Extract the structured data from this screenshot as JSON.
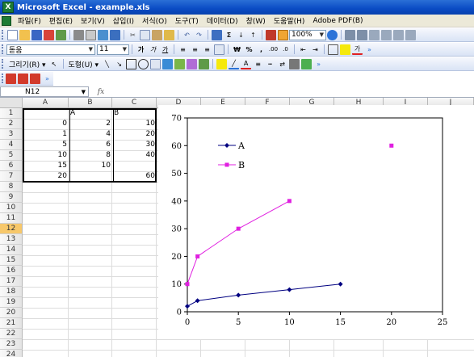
{
  "window": {
    "title": "Microsoft Excel - example.xls",
    "app_icon_label": "X"
  },
  "menu": [
    "파일(F)",
    "편집(E)",
    "보기(V)",
    "삽입(I)",
    "서식(O)",
    "도구(T)",
    "데이터(D)",
    "창(W)",
    "도움말(H)",
    "Adobe PDF(B)"
  ],
  "toolbar_standard": {
    "zoom": "100%",
    "sigma_label": "Σ"
  },
  "toolbar_format": {
    "font": "돋움",
    "size": "11",
    "bold": "가",
    "italic": "가",
    "underline": "가",
    "currency": "₩",
    "percent": "%",
    "comma": ",",
    "inc_decimal": ".00",
    "font_color": "가"
  },
  "toolbar_drawing": {
    "draw_menu": "그리기(R) ▾",
    "shapes_menu": "도형(U) ▾"
  },
  "formula_bar": {
    "name_box": "N12",
    "fx": "fx",
    "content": ""
  },
  "grid": {
    "columns": [
      "A",
      "B",
      "C",
      "D",
      "E",
      "F",
      "G",
      "H",
      "I",
      "J"
    ],
    "rows": [
      "1",
      "2",
      "3",
      "4",
      "5",
      "6",
      "7",
      "8",
      "9",
      "10",
      "11",
      "12",
      "13",
      "14",
      "15",
      "16",
      "17",
      "18",
      "19",
      "20",
      "21",
      "22",
      "23",
      "24"
    ],
    "active_row": "12",
    "data_rows": [
      [
        "",
        "A",
        "B"
      ],
      [
        "0",
        "2",
        "10"
      ],
      [
        "1",
        "4",
        "20"
      ],
      [
        "5",
        "6",
        "30"
      ],
      [
        "10",
        "8",
        "40"
      ],
      [
        "15",
        "10",
        ""
      ],
      [
        "20",
        "",
        "60"
      ]
    ]
  },
  "chart_data": {
    "type": "scatter",
    "x_ticks": [
      "0",
      "5",
      "10",
      "15",
      "20",
      "25"
    ],
    "y_ticks": [
      "0",
      "10",
      "20",
      "30",
      "40",
      "50",
      "60",
      "70"
    ],
    "xlim": [
      0,
      25
    ],
    "ylim": [
      0,
      70
    ],
    "legend_position": "top-left",
    "series": [
      {
        "name": "A",
        "color": "#000080",
        "marker": "diamond",
        "x": [
          0,
          1,
          5,
          10,
          15
        ],
        "y": [
          2,
          4,
          6,
          8,
          10
        ]
      },
      {
        "name": "B",
        "color": "#e020e0",
        "marker": "square",
        "x": [
          0,
          1,
          5,
          10,
          20
        ],
        "y": [
          10,
          20,
          30,
          40,
          60
        ],
        "connected_points": 4
      }
    ]
  }
}
